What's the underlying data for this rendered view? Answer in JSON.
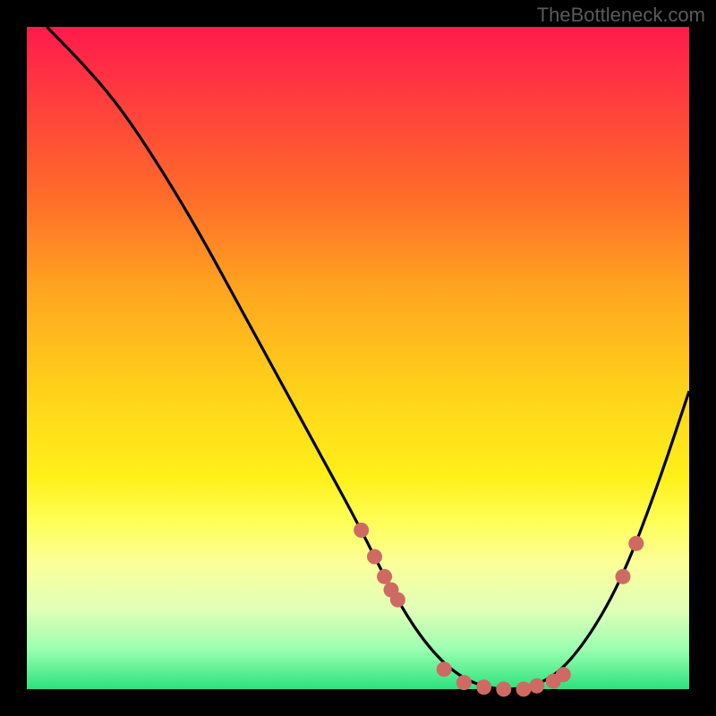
{
  "watermark": "TheBottleneck.com",
  "chart_data": {
    "type": "line",
    "title": "",
    "xlabel": "",
    "ylabel": "",
    "xlim": [
      0,
      100
    ],
    "ylim": [
      0,
      100
    ],
    "background_gradient": {
      "top": "#ff1a4d",
      "middle": "#ffd21a",
      "bottom": "#2be27d"
    },
    "series": [
      {
        "name": "bottleneck-curve",
        "x": [
          3,
          8,
          14,
          20,
          26,
          32,
          38,
          44,
          50,
          55,
          60,
          65,
          70,
          75,
          80,
          85,
          90,
          95,
          100
        ],
        "y": [
          100,
          95,
          88,
          79,
          69,
          58,
          47,
          36,
          25,
          15,
          7,
          2,
          0,
          0,
          2,
          8,
          17,
          30,
          45
        ]
      }
    ],
    "markers": {
      "name": "highlight-points",
      "color": "#cf6a63",
      "x": [
        50.5,
        52.5,
        54,
        55,
        56,
        63,
        66,
        69,
        72,
        75,
        77,
        79.5,
        81,
        90,
        92
      ],
      "y": [
        24,
        20,
        17,
        15,
        13.5,
        3,
        1,
        0.3,
        0,
        0,
        0.5,
        1.2,
        2.2,
        17,
        22
      ]
    }
  }
}
